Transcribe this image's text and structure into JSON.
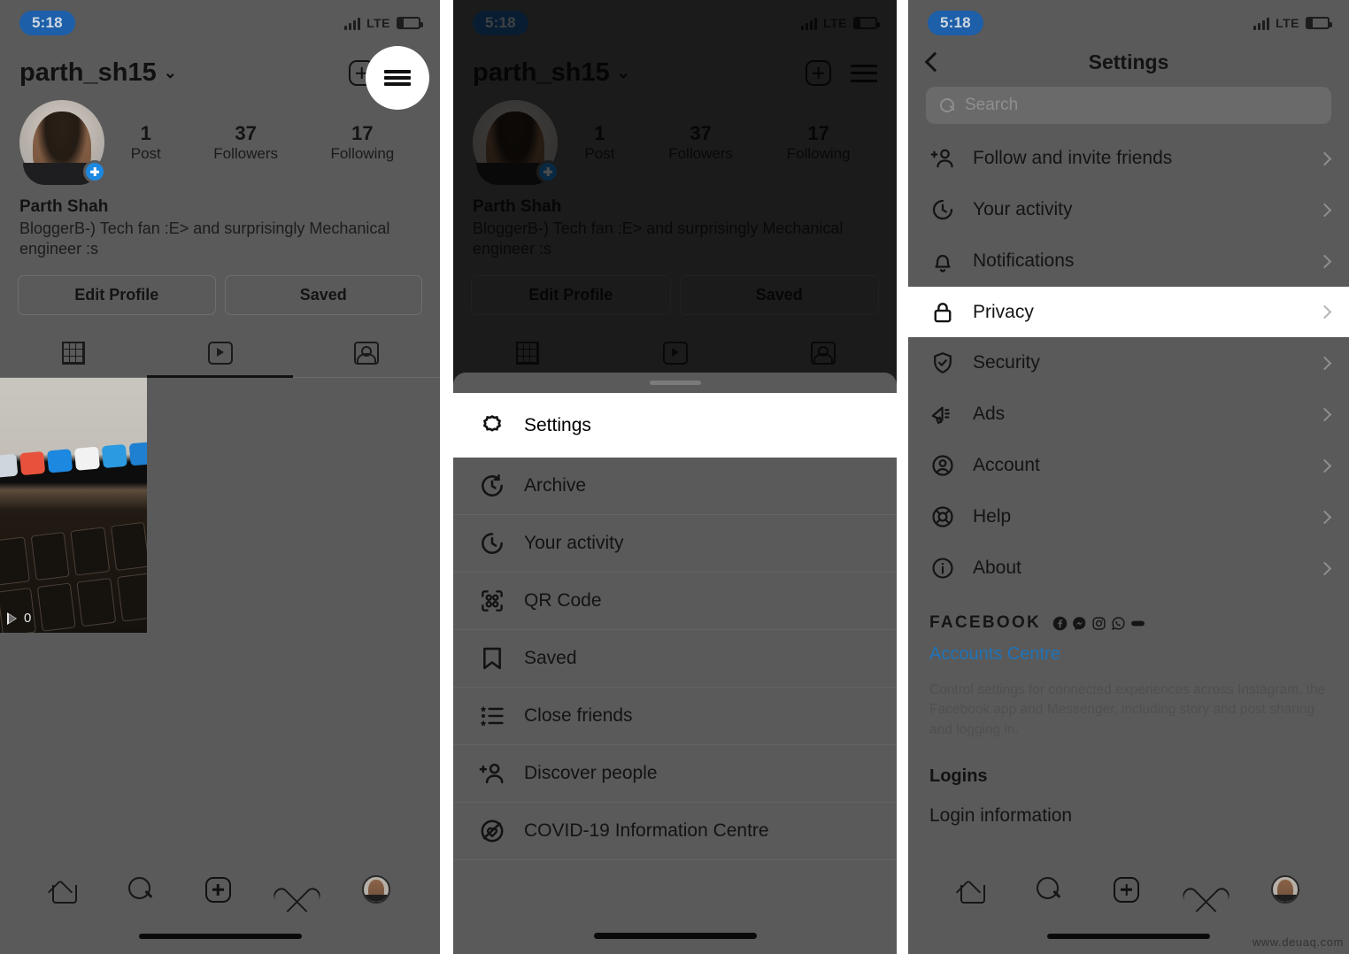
{
  "watermark": "www.deuaq.com",
  "status": {
    "time": "5:18",
    "network": "LTE"
  },
  "panel1": {
    "username": "parth_sh15",
    "caret": "⌄",
    "icons": {
      "add": "plus-box-icon",
      "menu": "hamburger-icon"
    },
    "stats": [
      {
        "num": "1",
        "label": "Post"
      },
      {
        "num": "37",
        "label": "Followers"
      },
      {
        "num": "17",
        "label": "Following"
      }
    ],
    "full_name": "Parth Shah",
    "bio": "BloggerB-) Tech fan :E> and surprisingly Mechanical engineer :s",
    "buttons": {
      "edit": "Edit Profile",
      "saved": "Saved"
    },
    "tabs": [
      {
        "icon": "grid-icon",
        "active": false
      },
      {
        "icon": "reels-icon",
        "active": true
      },
      {
        "icon": "tagged-icon",
        "active": false
      }
    ],
    "reel": {
      "play_count": "0"
    }
  },
  "panel2": {
    "username": "parth_sh15",
    "stats": [
      {
        "num": "1",
        "label": "Post"
      },
      {
        "num": "37",
        "label": "Followers"
      },
      {
        "num": "17",
        "label": "Following"
      }
    ],
    "full_name": "Parth Shah",
    "bio": "BloggerB-) Tech fan :E> and surprisingly Mechanical engineer :s",
    "buttons": {
      "edit": "Edit Profile",
      "saved": "Saved"
    },
    "menu": [
      {
        "label": "Settings",
        "icon": "gear-icon",
        "highlighted": true
      },
      {
        "label": "Archive",
        "icon": "archive-clock-icon",
        "highlighted": false
      },
      {
        "label": "Your activity",
        "icon": "activity-clock-icon",
        "highlighted": false
      },
      {
        "label": "QR Code",
        "icon": "qr-code-icon",
        "highlighted": false
      },
      {
        "label": "Saved",
        "icon": "bookmark-icon",
        "highlighted": false
      },
      {
        "label": "Close friends",
        "icon": "close-friends-list-icon",
        "highlighted": false
      },
      {
        "label": "Discover people",
        "icon": "add-person-icon",
        "highlighted": false
      },
      {
        "label": "COVID-19 Information Centre",
        "icon": "covid-info-icon",
        "highlighted": false
      }
    ]
  },
  "panel3": {
    "title": "Settings",
    "back_icon": "chevron-left-icon",
    "search": {
      "placeholder": "Search",
      "icon": "search-icon"
    },
    "items": [
      {
        "label": "Follow and invite friends",
        "icon": "add-person-icon",
        "highlighted": false
      },
      {
        "label": "Your activity",
        "icon": "activity-clock-icon",
        "highlighted": false
      },
      {
        "label": "Notifications",
        "icon": "bell-icon",
        "highlighted": false
      },
      {
        "label": "Privacy",
        "icon": "lock-icon",
        "highlighted": true
      },
      {
        "label": "Security",
        "icon": "shield-check-icon",
        "highlighted": false
      },
      {
        "label": "Ads",
        "icon": "megaphone-icon",
        "highlighted": false
      },
      {
        "label": "Account",
        "icon": "account-circle-icon",
        "highlighted": false
      },
      {
        "label": "Help",
        "icon": "lifebuoy-icon",
        "highlighted": false
      },
      {
        "label": "About",
        "icon": "info-circle-icon",
        "highlighted": false
      }
    ],
    "facebook": {
      "heading": "FACEBOOK",
      "icons": [
        "facebook-icon",
        "messenger-icon",
        "instagram-icon",
        "whatsapp-icon",
        "portal-icon"
      ],
      "link": "Accounts Centre",
      "description": "Control settings for connected experiences across Instagram, the Facebook app and Messenger, including story and post sharing and logging in."
    },
    "logins": {
      "heading": "Logins",
      "item": "Login information"
    }
  },
  "bottom_nav": [
    {
      "icon": "home-icon"
    },
    {
      "icon": "search-icon"
    },
    {
      "icon": "add-post-icon"
    },
    {
      "icon": "heart-icon"
    },
    {
      "icon": "profile-avatar-icon"
    }
  ],
  "colors": {
    "accent_blue": "#1d88e0",
    "link_blue": "#1f73b8",
    "highlight_white": "#ffffff"
  }
}
